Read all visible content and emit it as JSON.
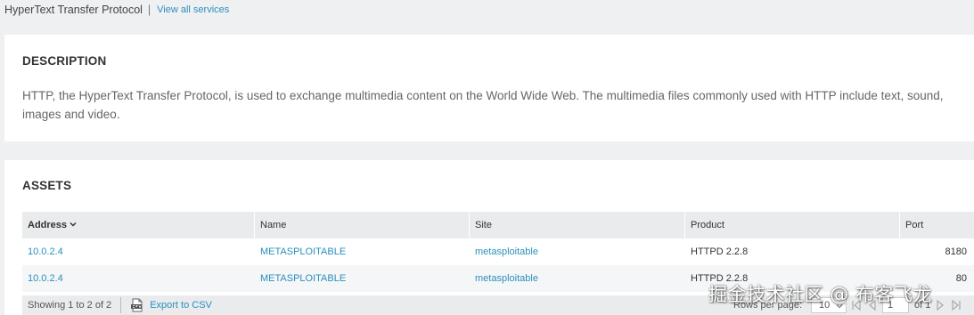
{
  "breadcrumb": {
    "title": "HyperText Transfer Protocol",
    "separator": "|",
    "link": "View all services"
  },
  "description": {
    "heading": "DESCRIPTION",
    "text": "HTTP, the HyperText Transfer Protocol, is used to exchange multimedia content on the World Wide Web. The multimedia files commonly used with HTTP include text, sound, images and video."
  },
  "assets": {
    "heading": "ASSETS",
    "columns": [
      "Address",
      "Name",
      "Site",
      "Product",
      "Port"
    ],
    "sorted_column": "Address",
    "rows": [
      {
        "address": "10.0.2.4",
        "name": "METASPLOITABLE",
        "site": "metasploitable",
        "product": "HTTPD 2.2.8",
        "port": "8180"
      },
      {
        "address": "10.0.2.4",
        "name": "METASPLOITABLE",
        "site": "metasploitable",
        "product": "HTTPD 2.2.8",
        "port": "80"
      }
    ],
    "footer": {
      "showing": "Showing 1 to 2 of 2",
      "export_label": "Export to CSV",
      "rows_per_page_label": "Rows per page:",
      "rows_per_page_value": "10",
      "page_value": "1",
      "of_pages": "of 1"
    }
  },
  "watermark": "掘金技术社区 @ 布客飞龙",
  "colors": {
    "link": "#2a8fbd",
    "panel": "#ffffff",
    "page_bg": "#eef0f1",
    "header_bg": "#e9ebec"
  },
  "icons": [
    "chevron-down-icon",
    "csv-file-icon",
    "first-page-icon",
    "previous-page-icon",
    "next-page-icon",
    "last-page-icon"
  ]
}
